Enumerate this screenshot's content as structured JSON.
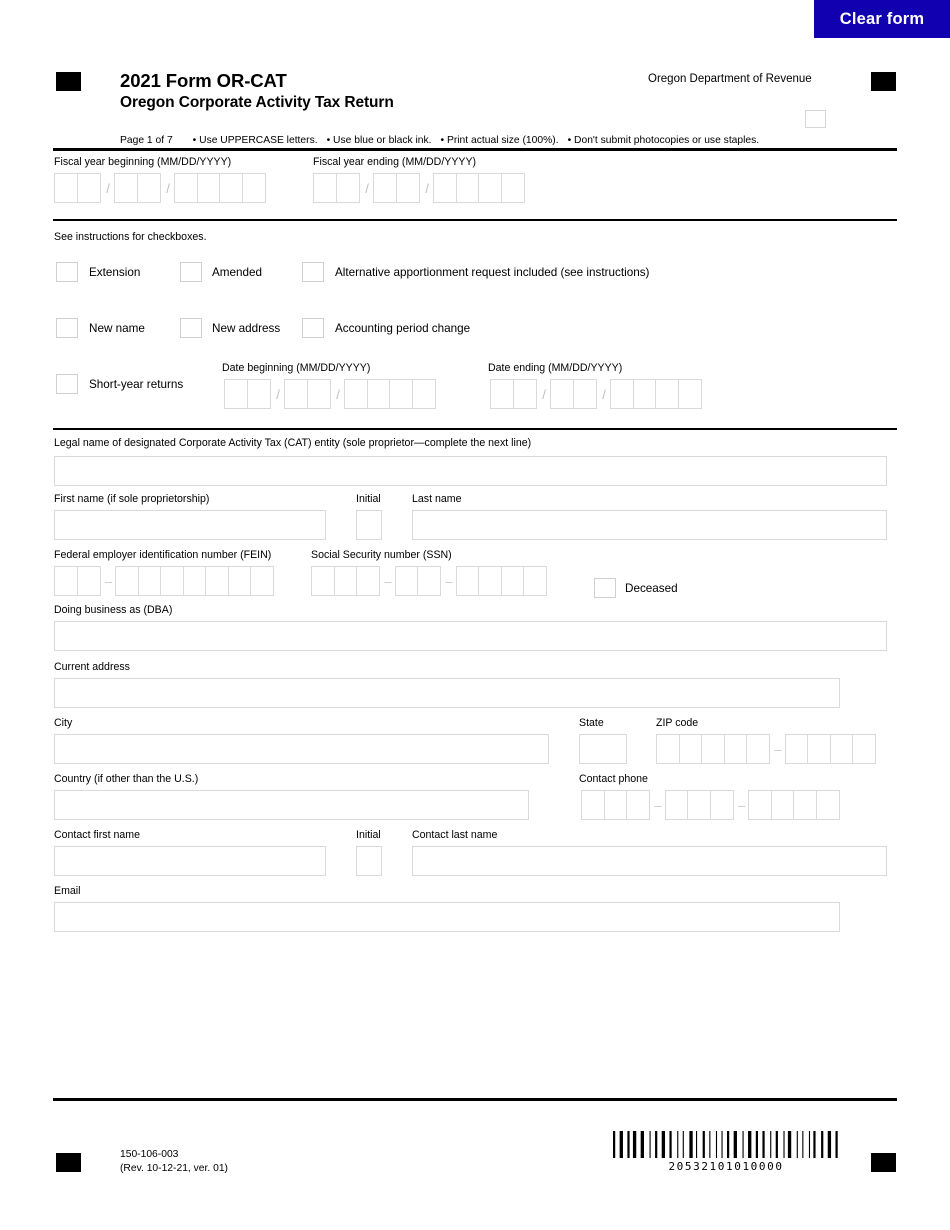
{
  "toolbar": {
    "clear_form_label": "Clear form"
  },
  "header": {
    "title": "2021 Form OR-CAT",
    "subtitle": "Oregon Corporate Activity Tax Return",
    "department": "Oregon Department of Revenue",
    "page_indicator": "Page 1 of 7",
    "instructions": [
      "• Use UPPERCASE letters.",
      "• Use blue or black ink.",
      "• Print actual size (100%).",
      "• Don't submit photocopies or use staples."
    ]
  },
  "fiscal_year": {
    "beginning_label": "Fiscal year beginning (MM/DD/YYYY)",
    "ending_label": "Fiscal year ending (MM/DD/YYYY)"
  },
  "checkbox_section": {
    "note": "See instructions for checkboxes.",
    "row1": [
      {
        "label": "Extension"
      },
      {
        "label": "Amended"
      },
      {
        "label": "Alternative apportionment request included (see instructions)"
      }
    ],
    "row2": [
      {
        "label": "New name"
      },
      {
        "label": "New address"
      },
      {
        "label": "Accounting period change"
      }
    ],
    "short_year": {
      "label": "Short-year returns",
      "date_beginning_label": "Date beginning (MM/DD/YYYY)",
      "date_ending_label": "Date ending (MM/DD/YYYY)"
    }
  },
  "entity": {
    "legal_name_label": "Legal name of designated Corporate Activity Tax (CAT) entity (sole proprietor—complete the next line)",
    "legal_name_value": "",
    "first_name_label": "First name (if sole proprietorship)",
    "first_name_value": "",
    "initial_label": "Initial",
    "initial_value": "",
    "last_name_label": "Last name",
    "last_name_value": "",
    "fein_label": "Federal employer identification number (FEIN)",
    "ssn_label": "Social Security number (SSN)",
    "deceased_label": "Deceased",
    "dba_label": "Doing business as (DBA)",
    "dba_value": ""
  },
  "address": {
    "current_address_label": "Current address",
    "current_address_value": "",
    "city_label": "City",
    "city_value": "",
    "state_label": "State",
    "state_value": "",
    "zip_label": "ZIP code",
    "country_label": "Country (if other than the U.S.)",
    "country_value": "",
    "contact_phone_label": "Contact phone"
  },
  "contact": {
    "first_name_label": "Contact first name",
    "first_name_value": "",
    "initial_label": "Initial",
    "initial_value": "",
    "last_name_label": "Contact last name",
    "last_name_value": "",
    "email_label": "Email",
    "email_value": ""
  },
  "footer": {
    "form_number": "150-106-003",
    "revision": "(Rev. 10-12-21, ver. 01)",
    "barcode_number": "20532101010000"
  },
  "colors": {
    "accent": "#1000b0",
    "field_border": "#d9d9d9",
    "rule": "#000000"
  }
}
